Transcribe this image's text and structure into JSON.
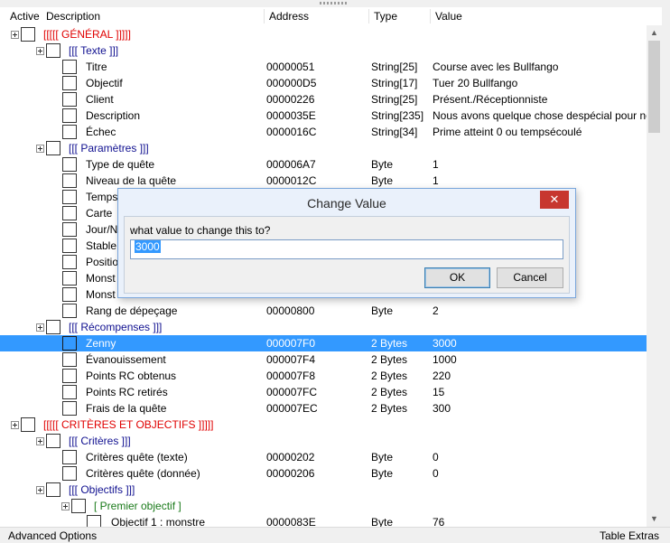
{
  "columns": {
    "active": "Active",
    "description": "Description",
    "address": "Address",
    "type": "Type",
    "value": "Value"
  },
  "rows": [
    {
      "desc": "[[[[[ GÉNÉRAL ]]]]]",
      "color": "#e00000",
      "level": 0,
      "expander": true
    },
    {
      "desc": "[[[ Texte ]]]",
      "color": "#101090",
      "level": 1,
      "expander": true
    },
    {
      "desc": "Titre",
      "address": "00000051",
      "type": "String[25]",
      "value": "Course avec les Bullfango",
      "level": 2
    },
    {
      "desc": "Objectif",
      "address": "000000D5",
      "type": "String[17]",
      "value": "Tuer 20 Bullfango",
      "level": 2
    },
    {
      "desc": "Client",
      "address": "00000226",
      "type": "String[25]",
      "value": "Présent./Réceptionniste",
      "level": 2
    },
    {
      "desc": "Description",
      "address": "0000035E",
      "type": "String[235]",
      "value": "Nous avons quelque chose despécial pour ne",
      "level": 2
    },
    {
      "desc": "Échec",
      "address": "0000016C",
      "type": "String[34]",
      "value": "Prime atteint 0 ou tempsécoulé",
      "level": 2
    },
    {
      "desc": "[[[ Paramètres ]]]",
      "color": "#101090",
      "level": 1,
      "expander": true
    },
    {
      "desc": "Type de quête",
      "address": "000006A7",
      "type": "Byte",
      "value": "1",
      "level": 2
    },
    {
      "desc": "Niveau de la quête",
      "address": "0000012C",
      "type": "Byte",
      "value": "1",
      "level": 2
    },
    {
      "desc": "Temps",
      "level": 2
    },
    {
      "desc": "Carte",
      "level": 2
    },
    {
      "desc": "Jour/N",
      "level": 2
    },
    {
      "desc": "Stable",
      "level": 2
    },
    {
      "desc": "Positio",
      "level": 2
    },
    {
      "desc": "Monst",
      "level": 2
    },
    {
      "desc": "Monst",
      "level": 2
    },
    {
      "desc": "Rang de dépeçage",
      "address": "00000800",
      "type": "Byte",
      "value": "2",
      "level": 2
    },
    {
      "desc": "[[[ Récompenses ]]]",
      "color": "#101090",
      "level": 1,
      "expander": true
    },
    {
      "desc": "Zenny",
      "address": "000007F0",
      "type": "2 Bytes",
      "value": "3000",
      "level": 2,
      "selected": true
    },
    {
      "desc": "Évanouissement",
      "address": "000007F4",
      "type": "2 Bytes",
      "value": "1000",
      "level": 2
    },
    {
      "desc": "Points RC obtenus",
      "address": "000007F8",
      "type": "2 Bytes",
      "value": "220",
      "level": 2
    },
    {
      "desc": "Points RC retirés",
      "address": "000007FC",
      "type": "2 Bytes",
      "value": "15",
      "level": 2
    },
    {
      "desc": "Frais de la quête",
      "address": "000007EC",
      "type": "2 Bytes",
      "value": "300",
      "level": 2
    },
    {
      "desc": "[[[[[ CRITÈRES ET OBJECTIFS ]]]]]",
      "color": "#e00000",
      "level": 0,
      "expander": true
    },
    {
      "desc": "[[[ Critères ]]]",
      "color": "#101090",
      "level": 1,
      "expander": true
    },
    {
      "desc": "Critères quête (texte)",
      "address": "00000202",
      "type": "Byte",
      "value": "0",
      "level": 2
    },
    {
      "desc": "Critères quête (donnée)",
      "address": "00000206",
      "type": "Byte",
      "value": "0",
      "level": 2
    },
    {
      "desc": "[[[ Objectifs ]]]",
      "color": "#101090",
      "level": 1,
      "expander": true
    },
    {
      "desc": "[ Premier objectif ]",
      "color": "#1a7a1a",
      "level": 2,
      "expander": true
    },
    {
      "desc": "Objectif 1 : monstre",
      "address": "0000083E",
      "type": "Byte",
      "value": "76",
      "level": 3
    }
  ],
  "dialog": {
    "title": "Change Value",
    "close_glyph": "✕",
    "prompt": "what value to change this to?",
    "value": "3000",
    "ok_label": "OK",
    "cancel_label": "Cancel"
  },
  "scrollbar": {
    "up_glyph": "▲",
    "down_glyph": "▼"
  },
  "status": {
    "left": "Advanced Options",
    "right": "Table Extras"
  }
}
